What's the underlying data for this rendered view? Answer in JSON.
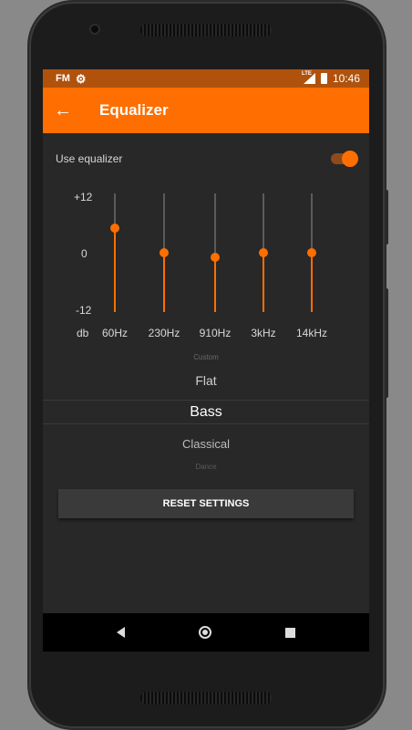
{
  "status_bar": {
    "app_badge": "FM",
    "network_type": "LTE",
    "time": "10:46"
  },
  "toolbar": {
    "title": "Equalizer"
  },
  "equalizer": {
    "toggle_label": "Use equalizer",
    "enabled": true,
    "scale_top": "+12",
    "scale_mid": "0",
    "scale_bottom": "-12",
    "unit_label": "db",
    "range_db": [
      -12,
      12
    ],
    "bands": [
      {
        "label": "60Hz",
        "gain_db": 5
      },
      {
        "label": "230Hz",
        "gain_db": 0
      },
      {
        "label": "910Hz",
        "gain_db": -1
      },
      {
        "label": "3kHz",
        "gain_db": 0
      },
      {
        "label": "14kHz",
        "gain_db": 0
      }
    ]
  },
  "presets": {
    "items": [
      "Custom",
      "Flat",
      "Bass",
      "Classical",
      "Dance"
    ],
    "selected": "Bass"
  },
  "actions": {
    "reset_label": "RESET SETTINGS"
  },
  "colors": {
    "accent": "#ff6e00",
    "status_bar": "#b0520c",
    "background": "#282828"
  }
}
